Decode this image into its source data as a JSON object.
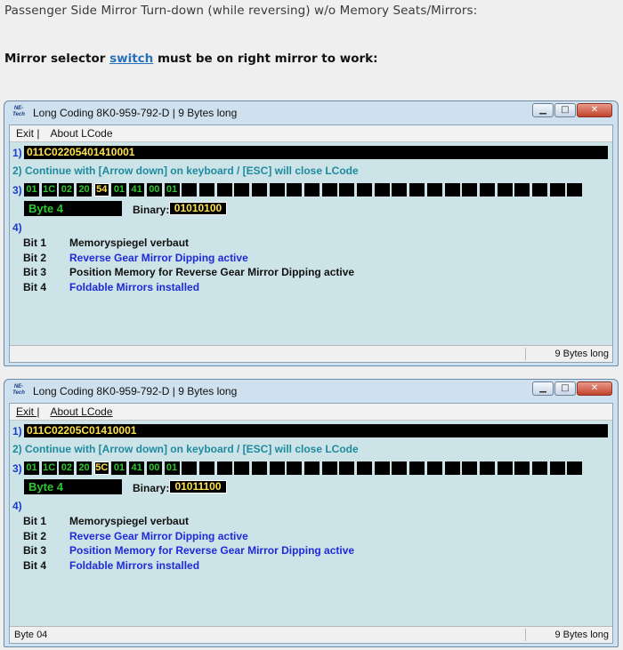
{
  "intro": "Passenger Side Mirror Turn-down (while reversing) w/o Memory Seats/Mirrors:",
  "instruction": {
    "before": "Mirror selector ",
    "link": "switch",
    "after": " must be on right mirror to work:"
  },
  "windows": [
    {
      "logo_text": "NE-Tech",
      "title": "Long Coding  8K0-959-792-D | 9 Bytes long",
      "menu": [
        "Exit |",
        "About LCode"
      ],
      "row1_num": "1)",
      "coding": "011C02205401410001",
      "row2": "2) Continue with [Arrow down] on keyboard / [ESC] will close LCode",
      "row3_num": "3)",
      "bytes": [
        "01",
        "1C",
        "02",
        "20",
        "54",
        "01",
        "41",
        "00",
        "01",
        "",
        "",
        "",
        "",
        "",
        "",
        "",
        "",
        "",
        "",
        "",
        "",
        "",
        "",
        "",
        "",
        "",
        "",
        "",
        "",
        "",
        "",
        ""
      ],
      "selected_index": 4,
      "byte_label": "Byte 4",
      "binary_label": "Binary:",
      "binary": "01010100",
      "row4_num": "4)",
      "bits": [
        {
          "name": "Bit 1",
          "desc": "Memoryspiegel verbaut",
          "active": false
        },
        {
          "name": "Bit 2",
          "desc": "Reverse Gear Mirror Dipping active",
          "active": true
        },
        {
          "name": "Bit 3",
          "desc": "Position Memory for Reverse Gear Mirror Dipping active",
          "active": false
        },
        {
          "name": "Bit 4",
          "desc": "Foldable Mirrors installed",
          "active": true
        }
      ],
      "status_left": "",
      "status_right": "9 Bytes long",
      "colors": {
        "active": "#1f2ad8",
        "inactive": "#111111",
        "byte_green": "#2ec82e",
        "byte_yellow": "#ffe24a"
      }
    },
    {
      "logo_text": "NE-Tech",
      "title": "Long Coding  8K0-959-792-D | 9 Bytes long",
      "menu": [
        "Exit |",
        "About LCode"
      ],
      "row1_num": "1)",
      "coding": "011C02205C01410001",
      "row2": "2) Continue with [Arrow down] on keyboard / [ESC] will close LCode",
      "row3_num": "3)",
      "bytes": [
        "01",
        "1C",
        "02",
        "20",
        "5C",
        "01",
        "41",
        "00",
        "01",
        "",
        "",
        "",
        "",
        "",
        "",
        "",
        "",
        "",
        "",
        "",
        "",
        "",
        "",
        "",
        "",
        "",
        "",
        "",
        "",
        "",
        "",
        ""
      ],
      "selected_index": 4,
      "byte_label": "Byte 4",
      "binary_label": "Binary:",
      "binary": "01011100",
      "row4_num": "4)",
      "bits": [
        {
          "name": "Bit 1",
          "desc": "Memoryspiegel verbaut",
          "active": false
        },
        {
          "name": "Bit 2",
          "desc": "Reverse Gear Mirror Dipping active",
          "active": true
        },
        {
          "name": "Bit 3",
          "desc": "Position Memory for Reverse Gear Mirror Dipping active",
          "active": true
        },
        {
          "name": "Bit 4",
          "desc": "Foldable Mirrors installed",
          "active": true
        }
      ],
      "status_left": "Byte 04",
      "status_right": "9 Bytes long",
      "colors": {
        "active": "#1f2ad8",
        "inactive": "#111111",
        "byte_green": "#2ec82e",
        "byte_yellow": "#ffe24a"
      }
    }
  ]
}
